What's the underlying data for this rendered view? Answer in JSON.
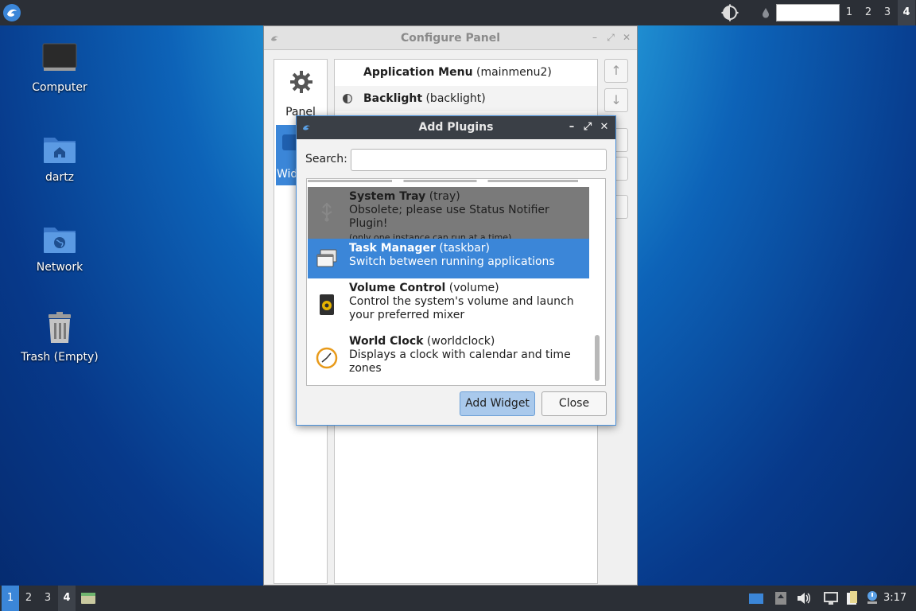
{
  "top_panel": {
    "workspaces": [
      "1",
      "2",
      "3",
      "4"
    ],
    "active_workspace": "4"
  },
  "desktop": {
    "icons": [
      {
        "label": "Computer"
      },
      {
        "label": "dartz"
      },
      {
        "label": "Network"
      },
      {
        "label": "Trash (Empty)"
      }
    ]
  },
  "configure_panel": {
    "title": "Configure Panel",
    "sidebar": {
      "panel_label": "Panel",
      "widgets_label": "Widgets"
    },
    "widgets": [
      {
        "name": "Application Menu",
        "id": "(mainmenu2)"
      },
      {
        "name": "Backlight",
        "id": "(backlight)"
      }
    ],
    "buttons": {
      "up": "↑",
      "down": "↓"
    }
  },
  "add_plugins": {
    "title": "Add Plugins",
    "search_label": "Search:",
    "search_value": "",
    "plugins": [
      {
        "name": "System Tray",
        "id": "(tray)",
        "description": "Obsolete; please use Status Notifier Plugin!",
        "note": "(only one instance can run at a time)",
        "state": "disabled"
      },
      {
        "name": "Task Manager",
        "id": "(taskbar)",
        "description": "Switch between running applications",
        "note": "",
        "state": "selected"
      },
      {
        "name": "Volume Control",
        "id": "(volume)",
        "description": "Control the system's volume and launch your preferred mixer",
        "note": "",
        "state": "normal"
      },
      {
        "name": "World Clock",
        "id": "(worldclock)",
        "description": "Displays a clock with calendar and time zones",
        "note": "",
        "state": "normal"
      }
    ],
    "add_button": "Add Widget",
    "close_button": "Close"
  },
  "bottom_panel": {
    "workspaces": [
      "1",
      "2",
      "3",
      "4"
    ],
    "current_workspace": "4",
    "clock": "3:17"
  },
  "colors": {
    "panel_bg": "#2b2f36",
    "accent": "#3b86d8",
    "disabled_row": "#7a7a7a"
  },
  "icons": {
    "app_menu": "lxqt-logo-icon",
    "brightness": "brightness-icon",
    "computer": "monitor-icon",
    "home_folder": "home-folder-icon",
    "network_folder": "network-folder-icon",
    "trash": "trash-icon",
    "panel": "gear-icon",
    "volume_tray": "speaker-icon",
    "clock_plugin": "clock-icon"
  }
}
